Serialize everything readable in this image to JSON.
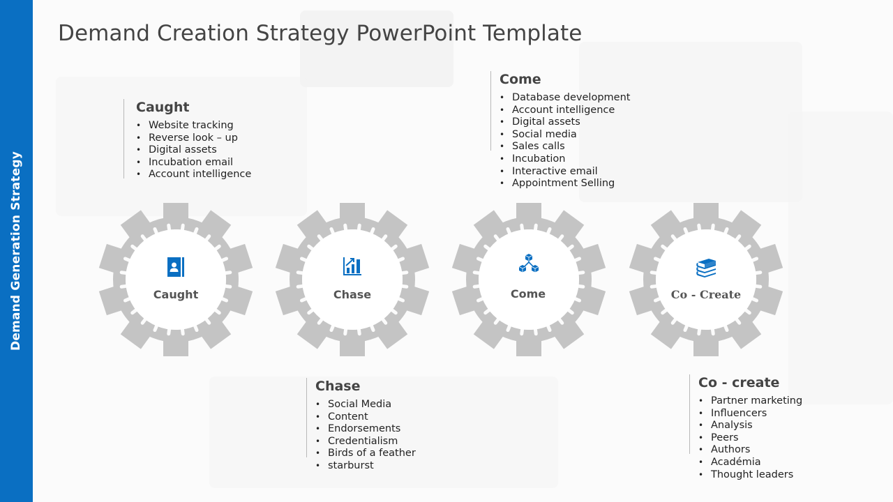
{
  "slide": {
    "title": "Demand Creation Strategy PowerPoint Template",
    "sidebar_label": "Demand Generation Strategy"
  },
  "colors": {
    "accent": "#0a6fc2",
    "gear": "#c4c4c4",
    "heading": "#444444",
    "text": "#222222"
  },
  "gears": [
    {
      "label": "Caught",
      "icon": "contact-book-icon"
    },
    {
      "label": "Chase",
      "icon": "bar-chart-growth-icon"
    },
    {
      "label": "Come",
      "icon": "connected-cubes-icon"
    },
    {
      "label": "Co - Create",
      "icon": "stacked-books-icon"
    }
  ],
  "blocks": {
    "caught": {
      "heading": "Caught",
      "items": [
        "Website tracking",
        "Reverse look – up",
        "Digital  assets",
        "Incubation  email",
        "Account intelligence"
      ]
    },
    "come": {
      "heading": "Come",
      "items": [
        "Database development",
        "Account intelligence",
        "Digital  assets",
        "Social media",
        "Sales calls",
        "Incubation",
        "Interactive email",
        "Appointment Selling"
      ]
    },
    "chase": {
      "heading": "Chase",
      "items": [
        "Social Media",
        "Content",
        "Endorsements",
        "Credentialism",
        "Birds of a feather",
        "starburst"
      ]
    },
    "cocreate": {
      "heading": "Co - create",
      "items": [
        "Partner marketing",
        "Influencers",
        "Analysis",
        "Peers",
        "Authors",
        "Académia",
        "Thought leaders"
      ]
    }
  }
}
